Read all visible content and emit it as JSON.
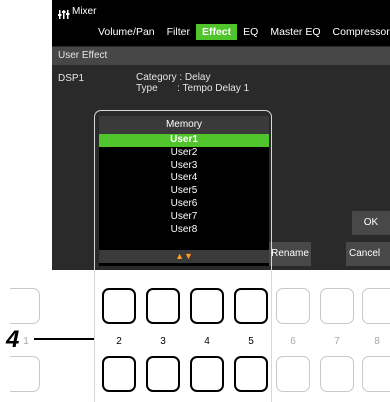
{
  "app": {
    "title": "Mixer",
    "icon": "mixer-icon"
  },
  "tabs": [
    {
      "label": "Volume/Pan",
      "active": false
    },
    {
      "label": "Filter",
      "active": false
    },
    {
      "label": "Effect",
      "active": true
    },
    {
      "label": "EQ",
      "active": false
    },
    {
      "label": "Master EQ",
      "active": false
    },
    {
      "label": "Compressor",
      "active": false
    }
  ],
  "section": {
    "title": "User Effect"
  },
  "dsp": {
    "label": "DSP1",
    "category_line": "Category : Delay",
    "type_line": "Type       : Tempo Delay 1"
  },
  "memory_popup": {
    "title": "Memory",
    "items": [
      "User1",
      "User2",
      "User3",
      "User4",
      "User5",
      "User6",
      "User7",
      "User8"
    ],
    "selected_index": 0,
    "scroll_arrows": "▲▼"
  },
  "buttons": {
    "rename": "Rename",
    "ok": "OK",
    "cancel": "Cancel"
  },
  "panel_buttons": {
    "numbers": [
      "1",
      "2",
      "3",
      "4",
      "5",
      "6",
      "7",
      "8"
    ],
    "highlighted": [
      "2",
      "3",
      "4",
      "5"
    ]
  },
  "callout": {
    "label": "4"
  },
  "colors": {
    "accent_green": "#4fc52b",
    "arrow_orange": "#ff9a1f",
    "screen_bg": "#2a2a2a"
  }
}
